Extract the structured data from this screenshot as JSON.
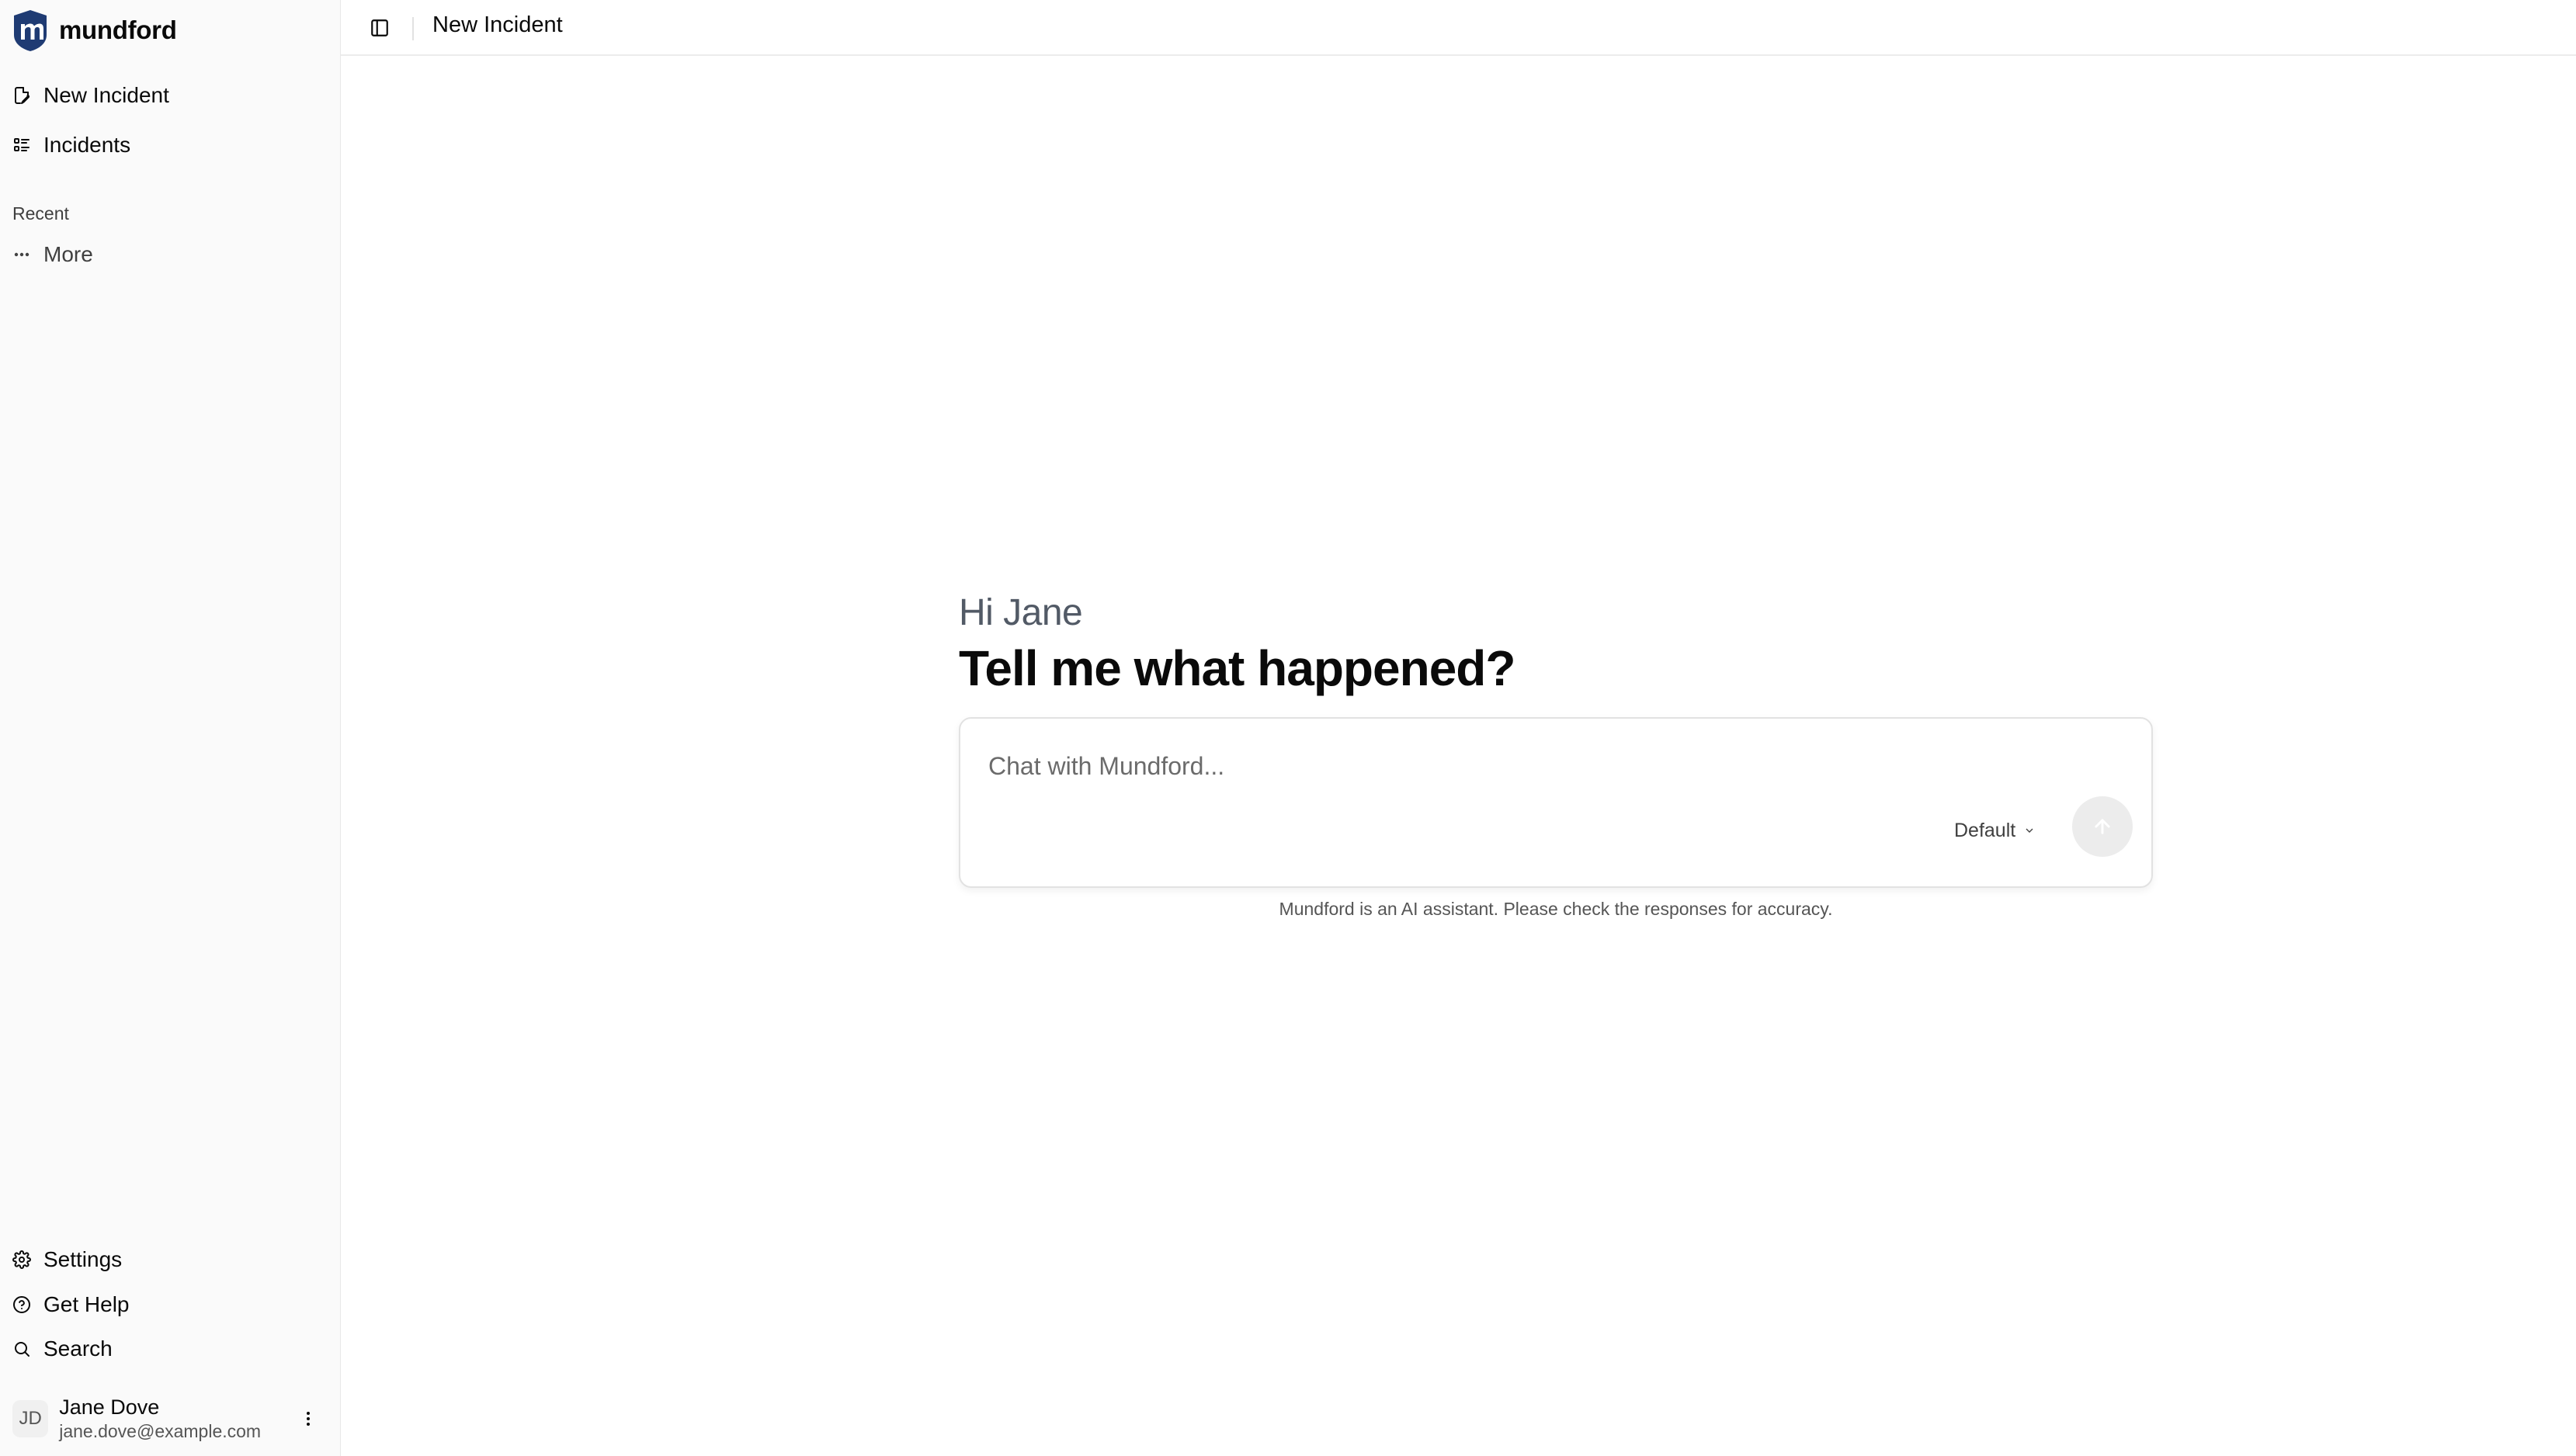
{
  "brand": {
    "name": "mundford",
    "logo_letter": "m",
    "color": "#1f3b73"
  },
  "sidebar": {
    "nav": [
      {
        "label": "New Incident",
        "icon": "file-pen-icon"
      },
      {
        "label": "Incidents",
        "icon": "list-icon"
      }
    ],
    "recent_label": "Recent",
    "more_label": "More",
    "footer": [
      {
        "label": "Settings",
        "icon": "gear-icon"
      },
      {
        "label": "Get Help",
        "icon": "help-circle-icon"
      },
      {
        "label": "Search",
        "icon": "search-icon"
      }
    ]
  },
  "user": {
    "initials": "JD",
    "name": "Jane Dove",
    "email": "jane.dove@example.com"
  },
  "header": {
    "title": "New Incident"
  },
  "main": {
    "greeting": "Hi Jane",
    "headline": "Tell me what happened?",
    "composer": {
      "placeholder": "Chat with Mundford...",
      "value": "",
      "model": "Default"
    },
    "disclaimer": "Mundford is an AI assistant. Please check the responses for accuracy."
  }
}
